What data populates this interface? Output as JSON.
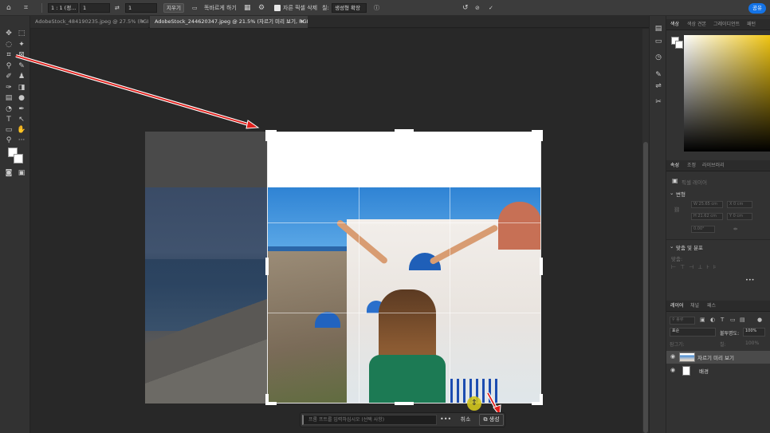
{
  "option_bar": {
    "ratio_value": "1 : 1 (정...",
    "width_value": "1",
    "height_value": "1",
    "clear_label": "지우기",
    "straighten_label": "똑바르게 하기",
    "delete_cropped_label": "자른 픽셀 삭제",
    "fill_label": "칠:",
    "fill_value": "생성형 확장",
    "share_label": "공유",
    "delete_cropped_checked": true
  },
  "tabs": [
    {
      "label": "AdobeStock_484190235.jpeg @ 27.5% (RGB/8) *",
      "close": "×"
    },
    {
      "label": "AdobeStock_244620347.jpeg @ 21.5% (자르기 미리 보기, RGB/8) *",
      "close": "×"
    }
  ],
  "taskbar": {
    "prompt_placeholder": "프롬 프트를 입력하십시오 (선택 사항)",
    "more_label": "•••",
    "cancel_label": "취소",
    "generate_label": "생성"
  },
  "panels": {
    "color_tabs": [
      "색상",
      "색상 견본",
      "그레이디언트",
      "패턴"
    ],
    "properties_tabs": [
      "속성",
      "조정",
      "라이브러리"
    ],
    "properties_subtitle": "픽셀 레이어",
    "transform_title": "변형",
    "transform_fields": [
      "W 25.65 cm",
      "X 0 cm",
      "H 21.62 cm",
      "Y 0 cm",
      "0.00°"
    ],
    "align_title": "맞춤 및 분포",
    "align_sub": "맞춤:",
    "more_dots": "•••",
    "layers_tabs": [
      "레이어",
      "채널",
      "패스"
    ],
    "layers_search": "종류",
    "blend_mode": "표준",
    "opacity_label": "불투명도:",
    "opacity_value": "100%",
    "lock_label": "잠그기:",
    "fill_label": "칠:",
    "fill_value": "100%",
    "layers": [
      {
        "name": "자르기 미리 보기",
        "visible": true,
        "selected": true
      },
      {
        "name": "배경",
        "visible": true,
        "selected": false
      }
    ]
  },
  "colors": {
    "accent": "#1473e6",
    "arrow": "#e0201c",
    "cursor": "#d2c51d"
  },
  "icons": {
    "home": "home-icon",
    "crop_tool": "crop-icon",
    "move": "move-icon",
    "marquee": "marquee-icon",
    "lasso": "lasso-icon",
    "eyedropper": "eyedropper-icon",
    "brush": "brush-icon",
    "eraser": "eraser-icon",
    "pen": "pen-icon",
    "type": "type-icon",
    "hand": "hand-icon",
    "zoom": "zoom-icon"
  }
}
